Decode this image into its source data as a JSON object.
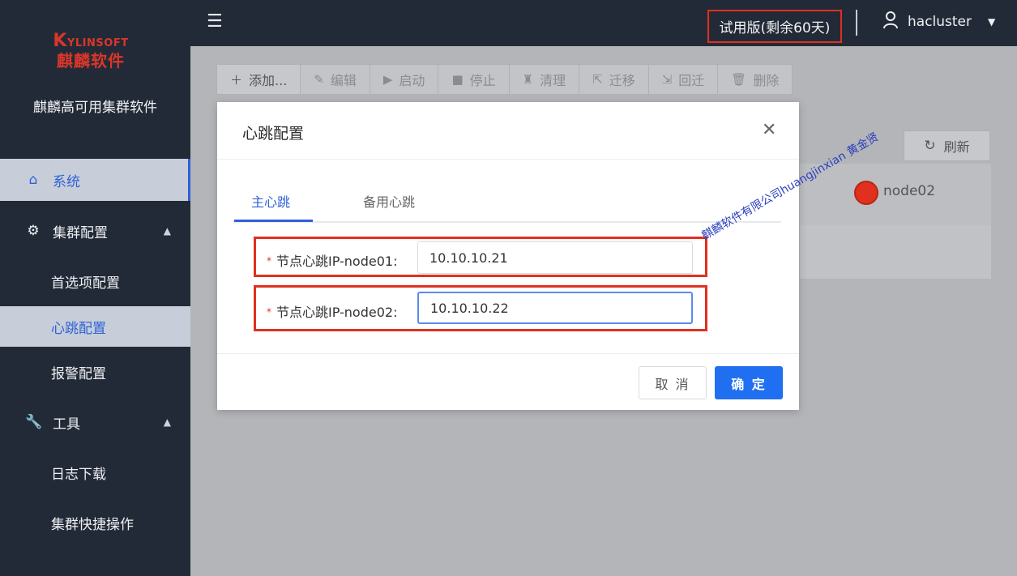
{
  "sidebar": {
    "logo_en_first": "K",
    "logo_en_rest": "YLINSOFT",
    "logo_cn": "麒麟软件",
    "app_name": "麒麟高可用集群软件",
    "items": [
      {
        "label": "系统",
        "icon": "home-icon"
      },
      {
        "label": "集群配置",
        "icon": "gear-icon"
      },
      {
        "label": "首选项配置"
      },
      {
        "label": "心跳配置"
      },
      {
        "label": "报警配置"
      },
      {
        "label": "工具",
        "icon": "wrench-icon"
      },
      {
        "label": "日志下载"
      },
      {
        "label": "集群快捷操作"
      }
    ]
  },
  "header": {
    "trial_text": "试用版(剩余60天)",
    "username": "hacluster"
  },
  "toolbar": {
    "buttons": [
      {
        "label": "添加..."
      },
      {
        "label": "编辑"
      },
      {
        "label": "启动"
      },
      {
        "label": "停止"
      },
      {
        "label": "清理"
      },
      {
        "label": "迁移"
      },
      {
        "label": "回迁"
      },
      {
        "label": "删除"
      }
    ],
    "refresh_label": "刷新"
  },
  "table": {
    "node_name": "node02"
  },
  "watermark": "麒麟软件有限公司huangjinxian 黄金贤",
  "modal": {
    "title": "心跳配置",
    "tabs": [
      "主心跳",
      "备用心跳"
    ],
    "fields": [
      {
        "label": "节点心跳IP-node01:",
        "value": "10.10.10.21"
      },
      {
        "label": "节点心跳IP-node02:",
        "value": "10.10.10.22"
      }
    ],
    "required_mark": "*",
    "cancel_label": "取 消",
    "ok_label": "确 定"
  },
  "colors": {
    "accent": "#2f61d6",
    "primary_button": "#1f6ff0",
    "highlight_border": "#e0301f",
    "sidebar_bg": "#232a37"
  }
}
